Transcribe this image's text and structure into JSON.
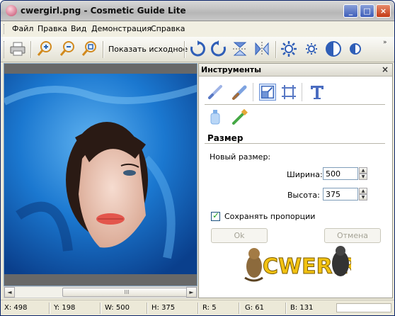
{
  "window": {
    "title": "cwergirl.png - Cosmetic Guide Lite"
  },
  "menu": [
    "Файл",
    "Правка",
    "Вид",
    "Демонстрация",
    "Справка"
  ],
  "toolbar": {
    "show_original": "Показать исходное",
    "more": "»",
    "icons": [
      "print-icon",
      "zoom-in-icon",
      "zoom-out-icon",
      "zoom-fit-icon",
      "rotate-cw-icon",
      "rotate-ccw-icon",
      "flip-vertical-icon",
      "flip-horizontal-icon",
      "brightness-up-icon",
      "brightness-down-icon",
      "contrast-up-icon",
      "contrast-down-icon"
    ]
  },
  "tools_panel": {
    "title": "Инструменты",
    "close": "×",
    "tools": [
      "brush-icon",
      "erase-brush-icon",
      "resize-icon",
      "crop-icon",
      "text-icon",
      "bottle-icon",
      "toothbrush-icon"
    ],
    "section_title": "Размер",
    "new_size_label": "Новый размер:",
    "width_label": "Ширина:",
    "width_value": "500",
    "height_label": "Высота:",
    "height_value": "375",
    "keep_proportions_label": "Сохранять пропорции",
    "keep_proportions_checked": true,
    "ok_label": "Ok",
    "cancel_label": "Отмена",
    "logo_text": "CWER.RU"
  },
  "statusbar": {
    "x": "X: 498",
    "y": "Y: 198",
    "w": "W: 500",
    "h": "H: 375",
    "r": "R: 5",
    "g": "G: 61",
    "b": "B: 131"
  },
  "scroll": {
    "left_arrow": "◄",
    "right_arrow": "►",
    "grip": "III"
  },
  "colors": {
    "titlebar": "#c4c4c4",
    "chrome": "#ece9d8",
    "accent_blue": "#3d5db9",
    "veil_blue": "#1e7fd4",
    "close_red": "#c43a16"
  }
}
